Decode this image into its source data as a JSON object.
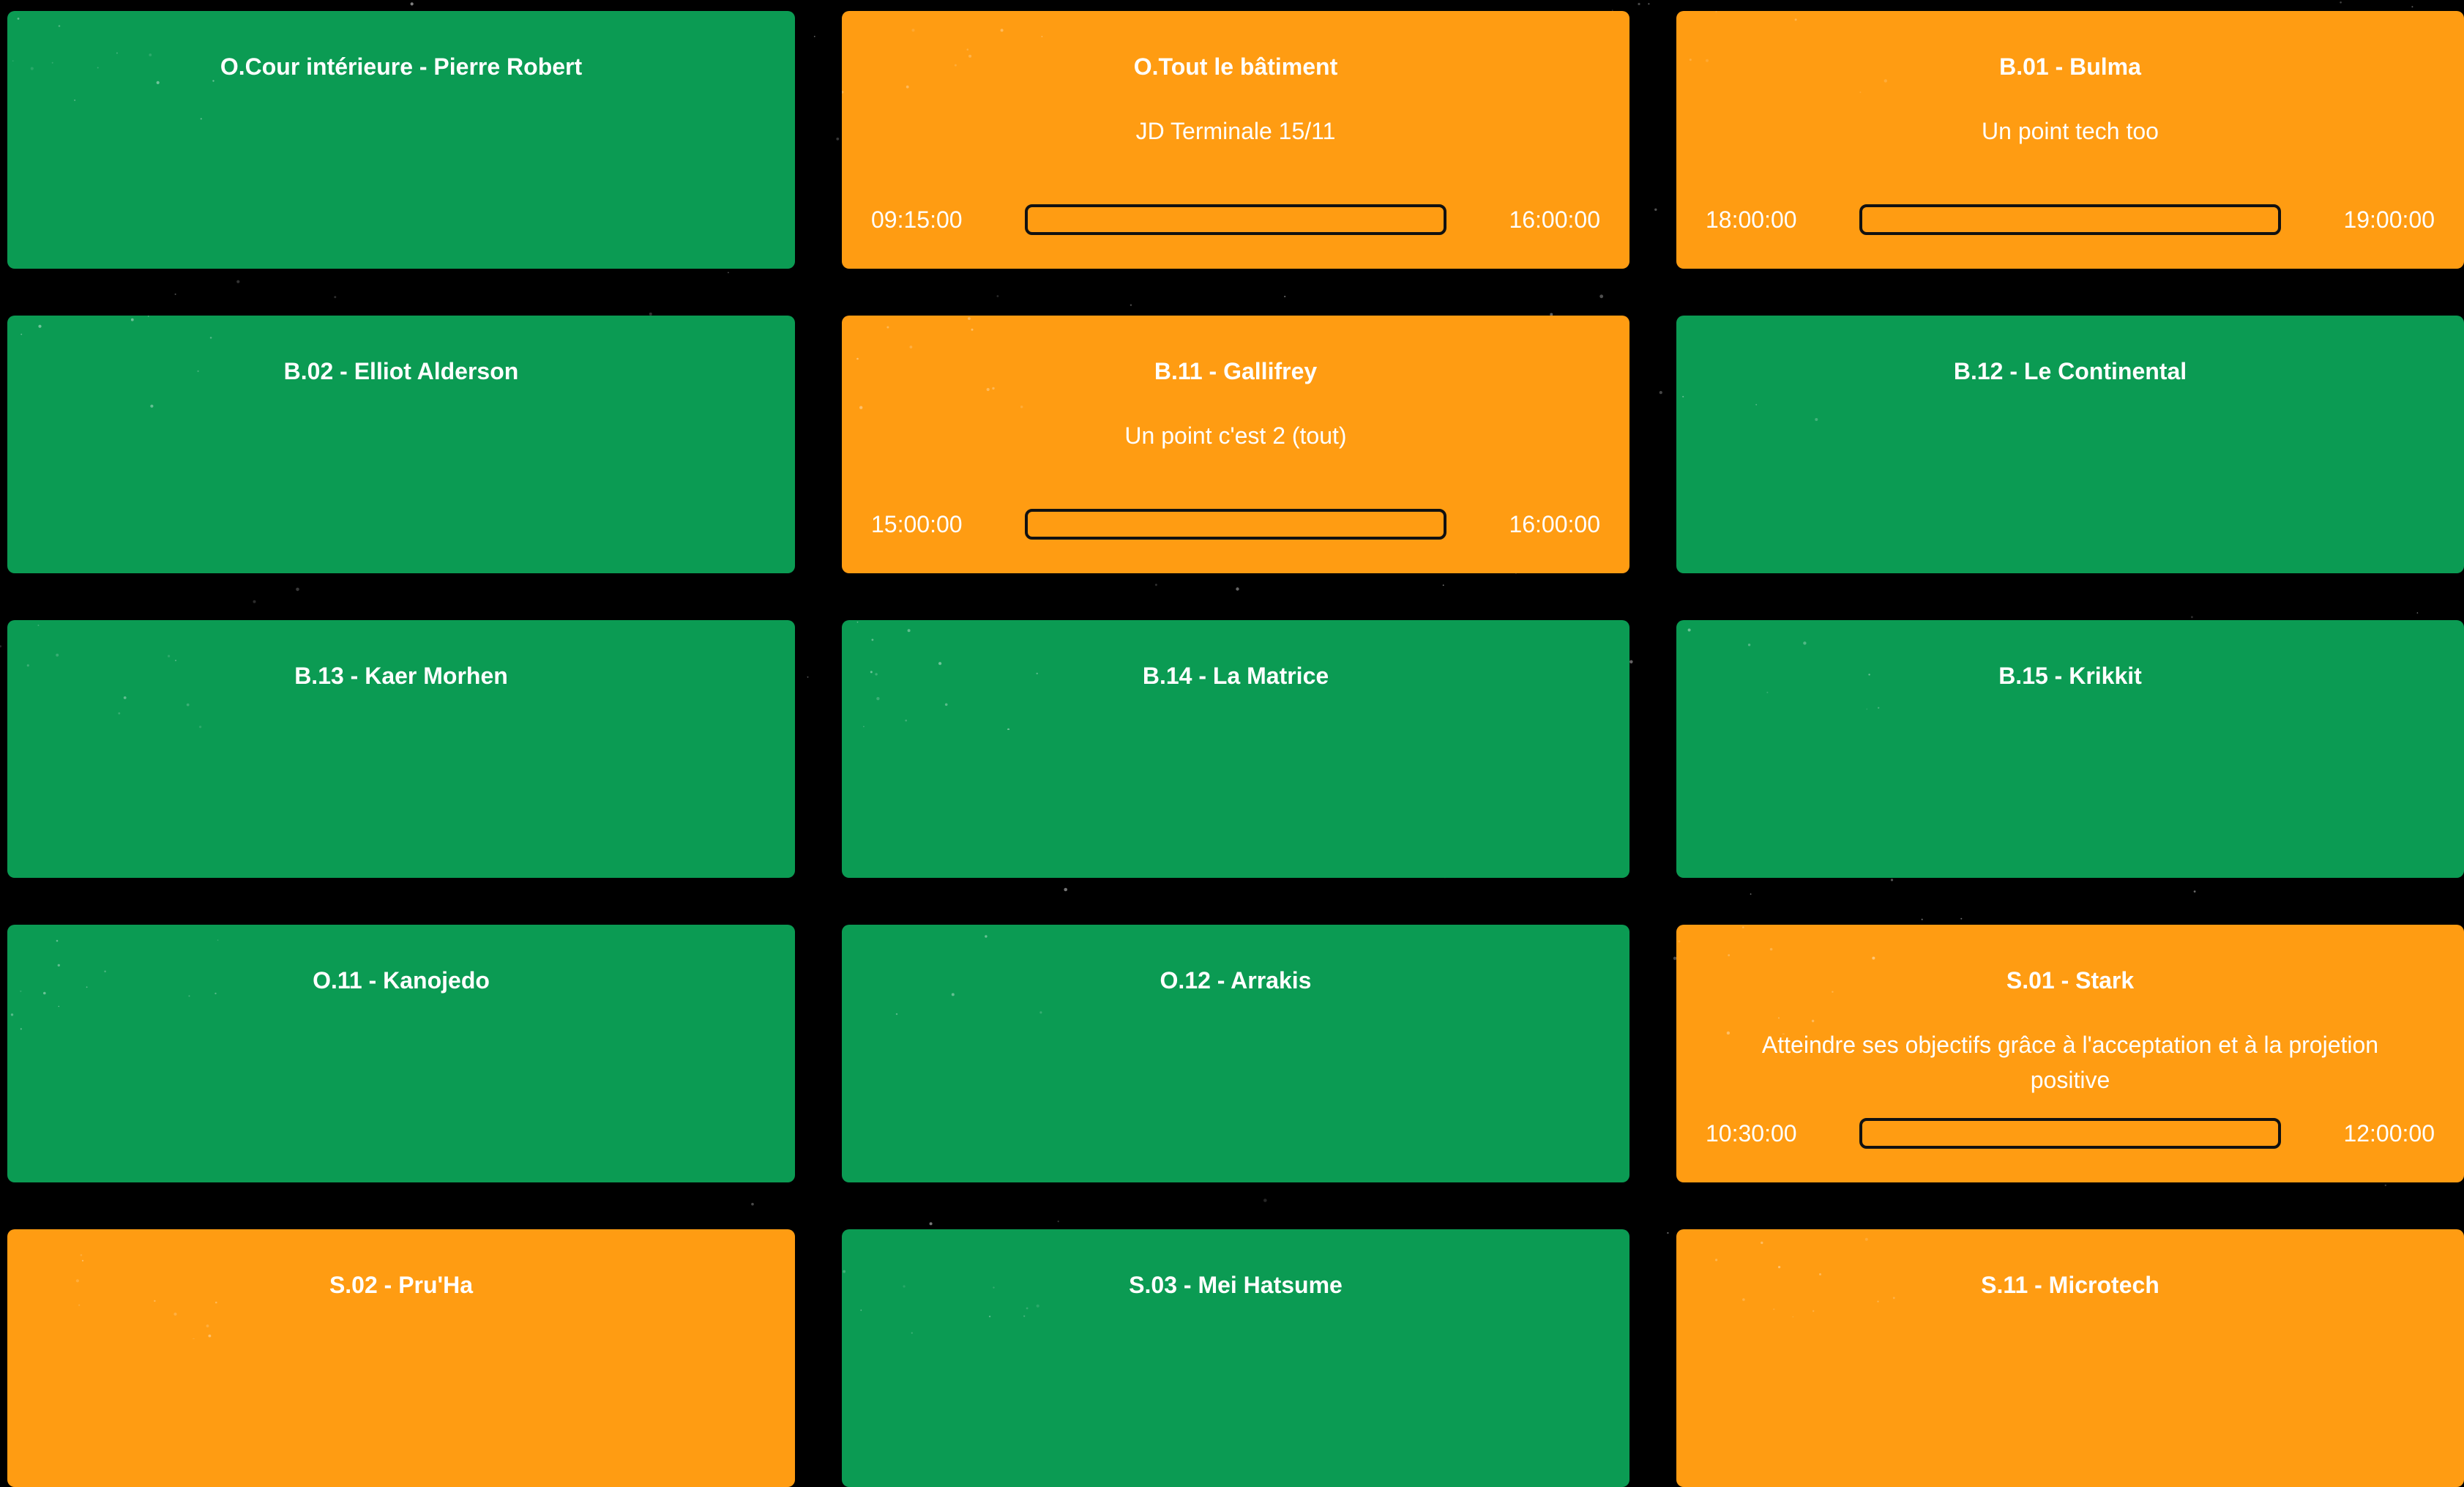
{
  "colors": {
    "free": "#0b9b53",
    "busy": "#ff9c12",
    "background": "#000000",
    "bar_border": "#111111"
  },
  "rooms": [
    {
      "name": "O.Cour intérieure - Pierre Robert",
      "status": "free"
    },
    {
      "name": "O.Tout le bâtiment",
      "status": "busy",
      "event": "JD Terminale 15/11",
      "start": "09:15:00",
      "end": "16:00:00",
      "progress": 0
    },
    {
      "name": "B.01 - Bulma",
      "status": "busy",
      "event": "Un point tech too",
      "start": "18:00:00",
      "end": "19:00:00",
      "progress": 0
    },
    {
      "name": "B.02 - Elliot Alderson",
      "status": "free"
    },
    {
      "name": "B.11 - Gallifrey",
      "status": "busy",
      "event": "Un point c'est 2 (tout)",
      "start": "15:00:00",
      "end": "16:00:00",
      "progress": 0
    },
    {
      "name": "B.12 - Le Continental",
      "status": "free"
    },
    {
      "name": "B.13 - Kaer Morhen",
      "status": "free"
    },
    {
      "name": "B.14 - La Matrice",
      "status": "free"
    },
    {
      "name": "B.15 - Krikkit",
      "status": "free"
    },
    {
      "name": "O.11 - Kanojedo",
      "status": "free"
    },
    {
      "name": "O.12 - Arrakis",
      "status": "free"
    },
    {
      "name": "S.01 - Stark",
      "status": "busy",
      "event": "Atteindre ses objectifs grâce à l'acceptation et à la projetion positive",
      "start": "10:30:00",
      "end": "12:00:00",
      "progress": 0
    },
    {
      "name": "S.02 - Pru'Ha",
      "status": "busy"
    },
    {
      "name": "S.03 - Mei Hatsume",
      "status": "free"
    },
    {
      "name": "S.11 - Microtech",
      "status": "busy"
    }
  ]
}
